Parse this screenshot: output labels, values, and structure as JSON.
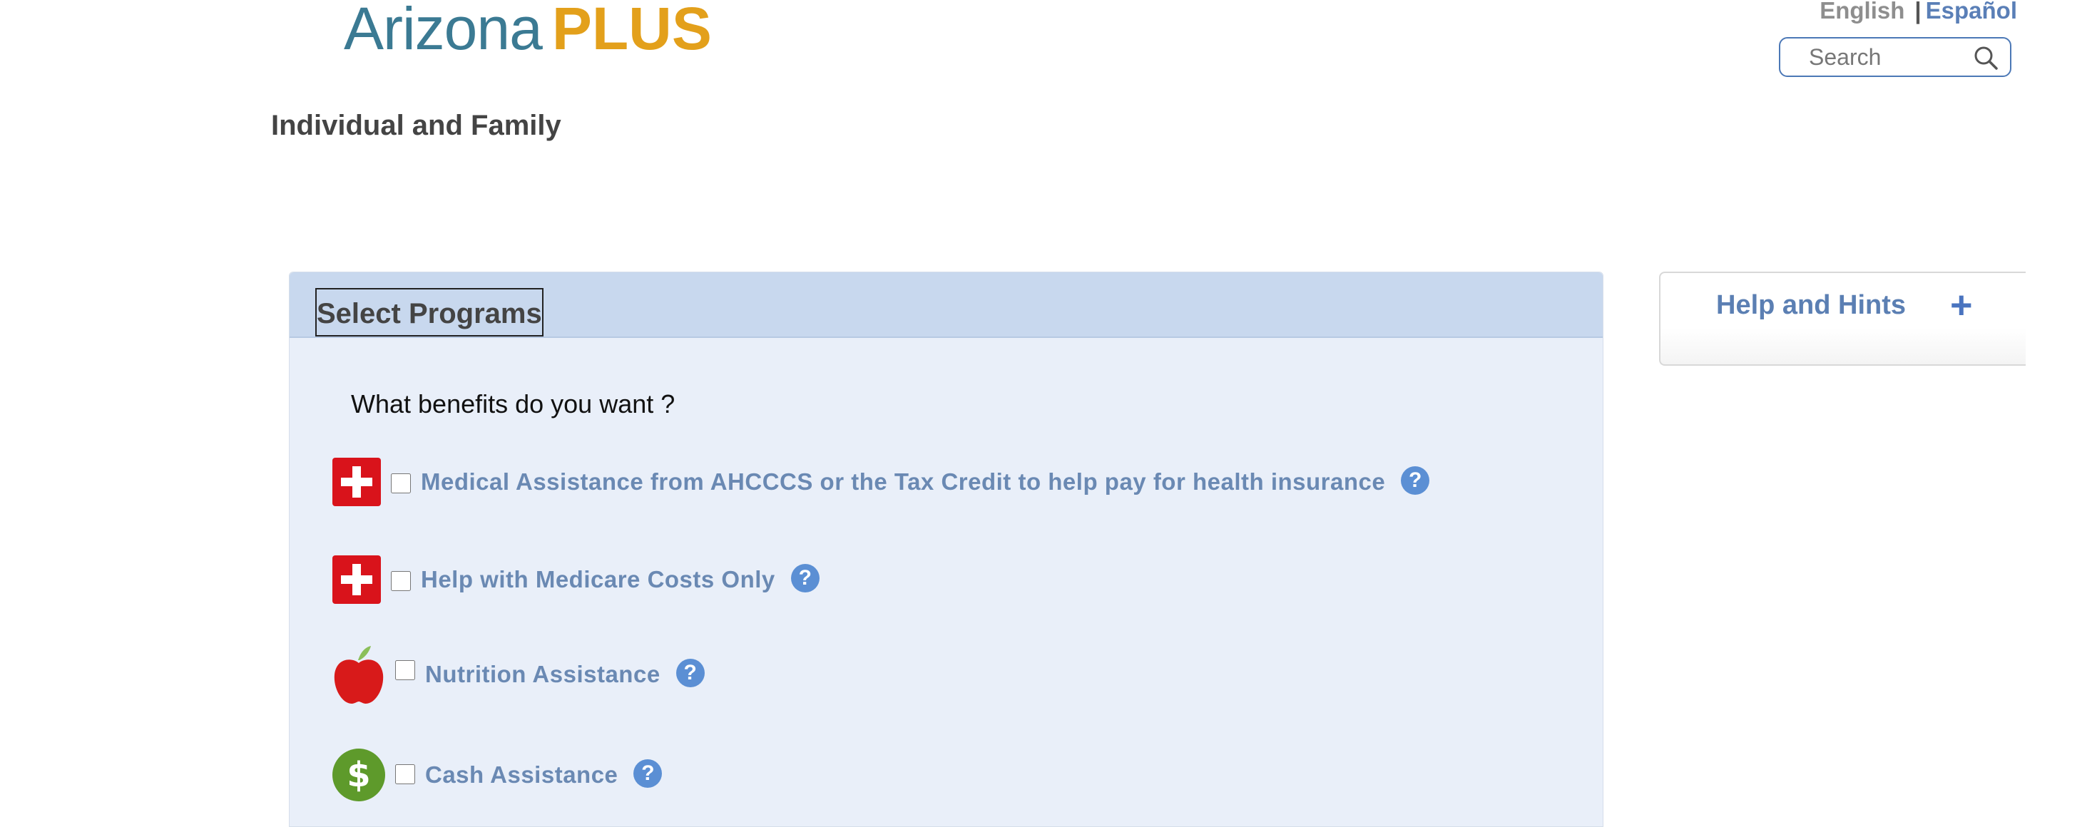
{
  "header": {
    "logo_part1": "Arizona",
    "logo_part2": "PLUS",
    "lang_english": "English",
    "lang_separator": "|",
    "lang_spanish": "Español",
    "search_placeholder": "Search",
    "page_title": "Individual and Family"
  },
  "panel": {
    "heading": "Select Programs",
    "question": "What benefits do you want ?",
    "programs": [
      {
        "label": "Medical Assistance from AHCCCS or the Tax Credit to help pay for health insurance",
        "icon": "medical-cross-icon",
        "checked": false
      },
      {
        "label": "Help with Medicare Costs Only",
        "icon": "medical-cross-icon",
        "checked": false
      },
      {
        "label": "Nutrition Assistance",
        "icon": "apple-icon",
        "checked": false
      },
      {
        "label": "Cash Assistance",
        "icon": "dollar-icon",
        "checked": false
      }
    ],
    "help_glyph": "?"
  },
  "hints": {
    "title": "Help and Hints",
    "expand_glyph": "+"
  },
  "colors": {
    "panel_bg": "#e9eff9",
    "panel_header_bg": "#c8d8ee",
    "label": "#6a89b3",
    "help_icon": "#5b8fd4",
    "medical_red": "#d9131b",
    "cash_green": "#5e9a2b",
    "logo_blue": "#3b7a93",
    "logo_orange": "#e3a01b"
  }
}
